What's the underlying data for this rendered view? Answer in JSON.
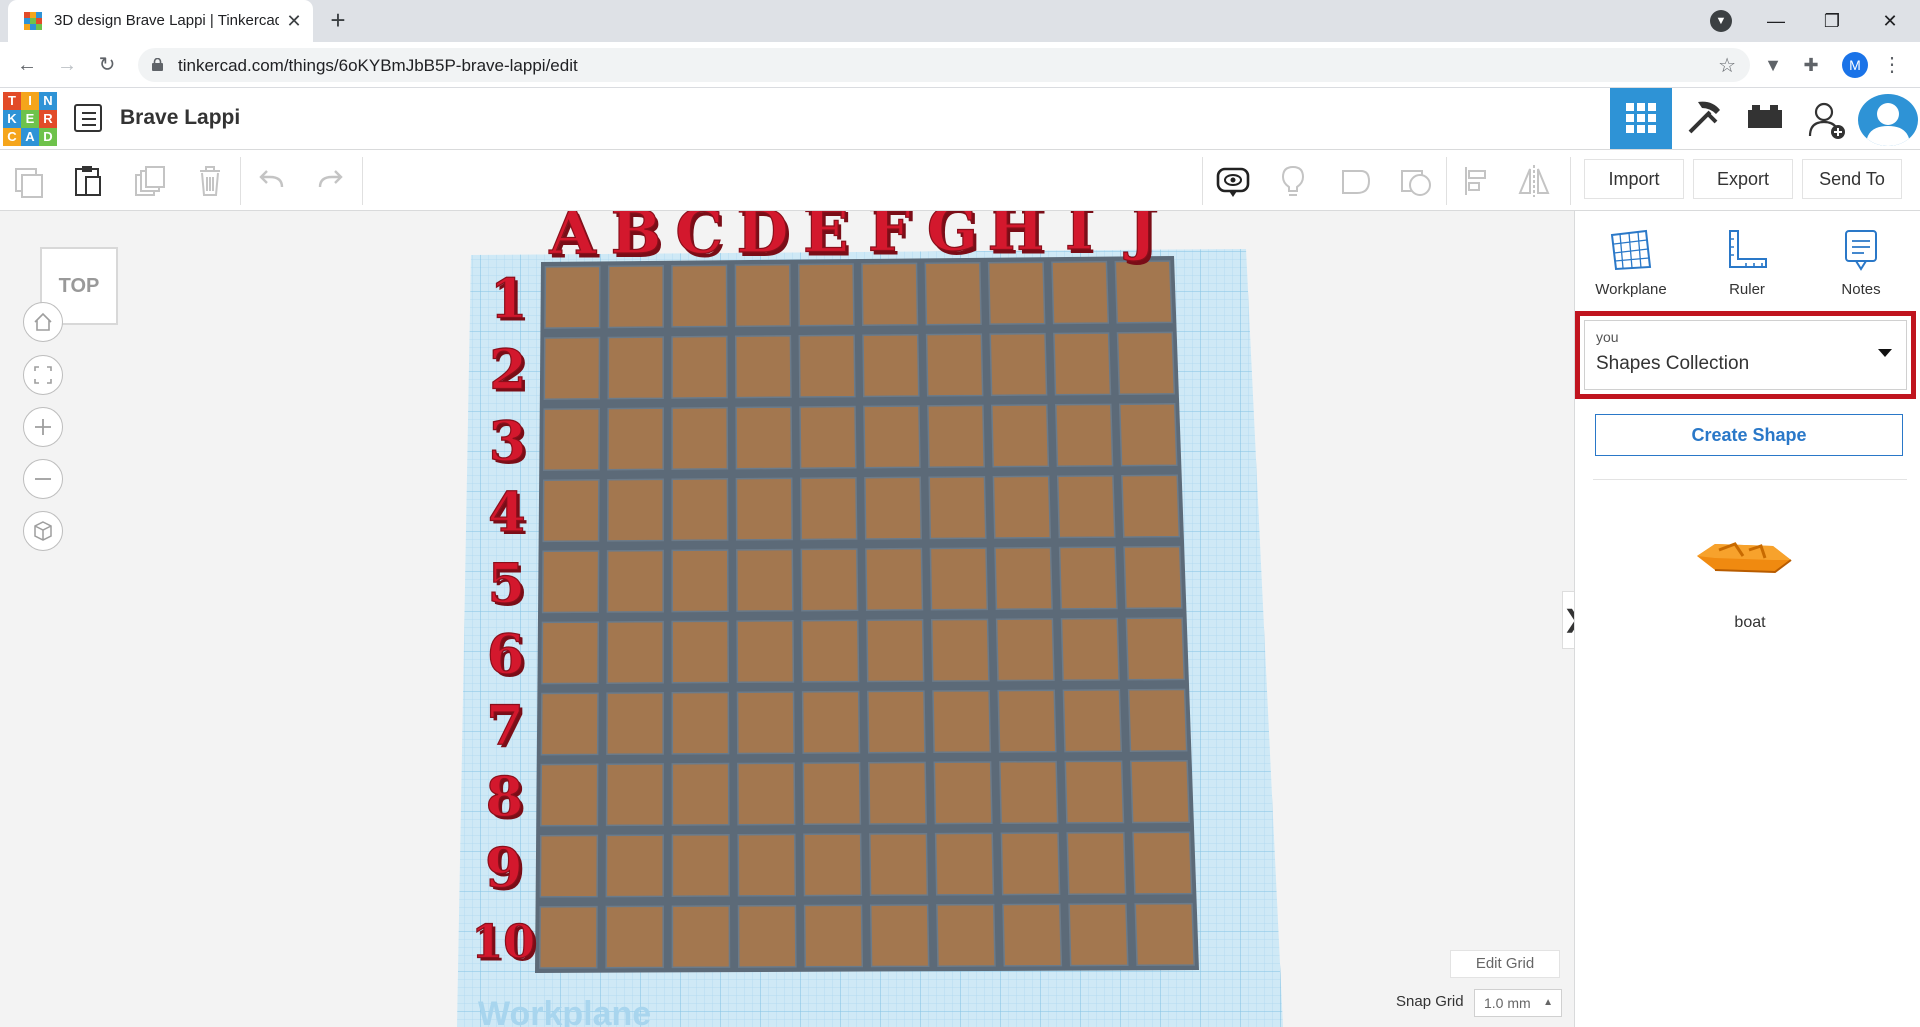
{
  "browser": {
    "tab_title": "3D design Brave Lappi | Tinkercad",
    "tab_close": "✕",
    "new_tab": "+",
    "url": "tinkercad.com/things/6oKYBmJbB5P-brave-lappi/edit",
    "profile_initial": "M",
    "window_controls": {
      "minimize": "—",
      "maximize": "❐",
      "close": "✕"
    }
  },
  "header": {
    "logo_letters": [
      "T",
      "I",
      "N",
      "K",
      "E",
      "R",
      "C",
      "A",
      "D"
    ],
    "logo_colors": [
      "#e24b28",
      "#f5a51b",
      "#2e93d6",
      "#2e93d6",
      "#6ec24b",
      "#e24b28",
      "#f5a51b",
      "#2e93d6",
      "#6ec24b"
    ],
    "design_title": "Brave Lappi",
    "views": [
      "3d-design-view-icon",
      "codeblocks-icon",
      "bricks-icon"
    ],
    "active_view": "3d-design-view-icon"
  },
  "toolbar": {
    "left_tools": [
      "copy-icon",
      "paste-icon",
      "duplicate-icon",
      "delete-icon",
      "undo-icon",
      "redo-icon"
    ],
    "right_tools": [
      "notes-visibility-icon",
      "light-bulb-icon",
      "group-icon",
      "ungroup-icon",
      "align-icon",
      "mirror-icon"
    ],
    "import_label": "Import",
    "export_label": "Export",
    "send_to_label": "Send To"
  },
  "canvas": {
    "view_label": "TOP",
    "workplane_text": "Workplane",
    "column_labels": [
      "A",
      "B",
      "C",
      "D",
      "E",
      "F",
      "G",
      "H",
      "I",
      "J"
    ],
    "row_labels": [
      "1",
      "2",
      "3",
      "4",
      "5",
      "6",
      "7",
      "8",
      "9",
      "10"
    ],
    "edit_grid_label": "Edit Grid",
    "snap_grid_label": "Snap Grid",
    "snap_grid_value": "1.0 mm",
    "colors": {
      "workplane": "#cfe9f6",
      "tile": "#a3774f",
      "letters": "#d3182d"
    }
  },
  "panel": {
    "tools": [
      {
        "label": "Workplane",
        "icon": "workplane-icon"
      },
      {
        "label": "Ruler",
        "icon": "ruler-icon"
      },
      {
        "label": "Notes",
        "icon": "notes-icon"
      }
    ],
    "collection_owner": "you",
    "collection_name": "Shapes Collection",
    "create_shape_label": "Create Shape",
    "shapes": [
      {
        "label": "boat",
        "icon": "boat-shape-icon"
      }
    ],
    "collapse_glyph": "❯"
  }
}
